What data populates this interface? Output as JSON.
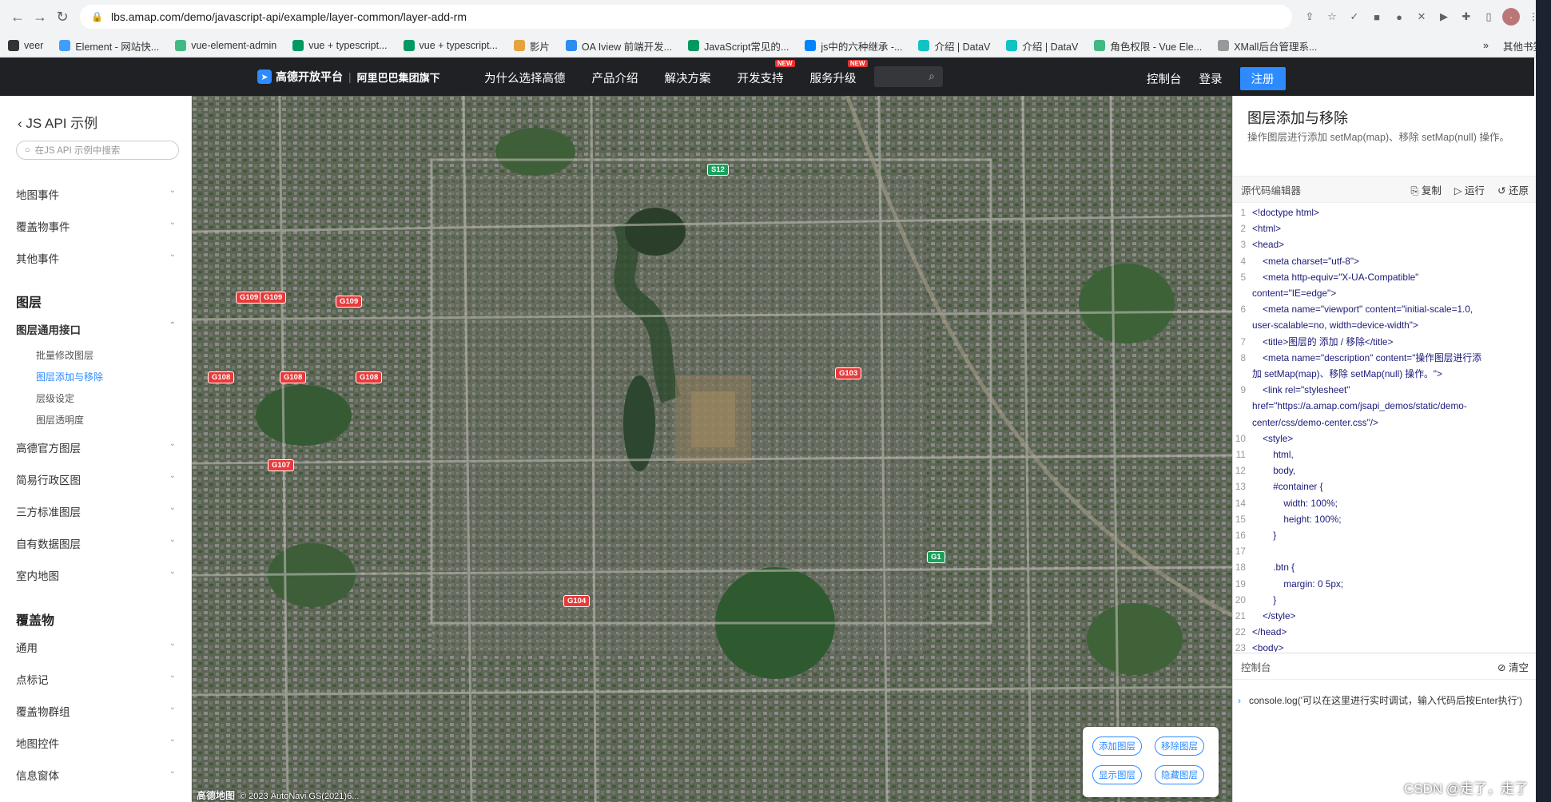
{
  "browser": {
    "url": "lbs.amap.com/demo/javascript-api/example/layer-common/layer-add-rm",
    "bookmarks": [
      {
        "label": "veer",
        "color": "#333"
      },
      {
        "label": "Element - 网站快...",
        "color": "#409eff"
      },
      {
        "label": "vue-element-admin",
        "color": "#42b983"
      },
      {
        "label": "vue + typescript...",
        "color": "#009a61"
      },
      {
        "label": "vue + typescript...",
        "color": "#009a61"
      },
      {
        "label": "影片",
        "color": "#e6a23c"
      },
      {
        "label": "OA Iview 前端开发...",
        "color": "#2d8cf0"
      },
      {
        "label": "JavaScript常见的...",
        "color": "#009a61"
      },
      {
        "label": "js中的六种继承 -...",
        "color": "#0084ff"
      },
      {
        "label": "介绍 | DataV",
        "color": "#13c2c2"
      },
      {
        "label": "介绍 | DataV",
        "color": "#13c2c2"
      },
      {
        "label": "角色权限 - Vue Ele...",
        "color": "#42b983"
      },
      {
        "label": "XMall后台管理系...",
        "color": "#999"
      }
    ],
    "bookmarks_more": "»",
    "other_bookmarks": "其他书签"
  },
  "topnav": {
    "logo": "高德开放平台",
    "logo_sub": "阿里巴巴集团旗下",
    "menu": [
      "为什么选择高德",
      "产品介绍",
      "解决方案",
      "开发支持",
      "服务升级"
    ],
    "new_tag": "NEW",
    "console": "控制台",
    "login": "登录",
    "register": "注册"
  },
  "sidebar": {
    "back": "JS API 示例",
    "search_placeholder": "在JS API 示例中搜索",
    "events": [
      "地图事件",
      "覆盖物事件",
      "其他事件"
    ],
    "layers_head": "图层",
    "layer_common": "图层通用接口",
    "layer_subs": [
      "批量修改图层",
      "图层添加与移除",
      "层级设定",
      "图层透明度"
    ],
    "layer_groups": [
      "高德官方图层",
      "简易行政区图",
      "三方标准图层",
      "自有数据图层",
      "室内地图"
    ],
    "overlays_head": "覆盖物",
    "overlay_groups": [
      "通用",
      "点标记",
      "覆盖物群组",
      "地图控件",
      "信息窗体"
    ]
  },
  "map": {
    "road_labels": [
      {
        "t": "G109",
        "green": false
      },
      {
        "t": "G109",
        "green": false
      },
      {
        "t": "G109",
        "green": false
      },
      {
        "t": "G108",
        "green": false
      },
      {
        "t": "G108",
        "green": false
      },
      {
        "t": "G108",
        "green": false
      },
      {
        "t": "G107",
        "green": false
      },
      {
        "t": "G103",
        "green": false
      },
      {
        "t": "G104",
        "green": false
      },
      {
        "t": "S12",
        "green": true
      },
      {
        "t": "G1",
        "green": true
      }
    ],
    "buttons": {
      "add": "添加图层",
      "remove": "移除图层",
      "show": "显示图层",
      "hide": "隐藏图层"
    },
    "footer_brand": "高德地图",
    "footer_copy": "© 2023 AutoNavi GS(2021)6..."
  },
  "panel": {
    "title": "图层添加与移除",
    "desc": "操作图层进行添加 setMap(map)、移除 setMap(null) 操作。",
    "editor_label": "源代码编辑器",
    "copy": "复制",
    "run": "运行",
    "restore": "还原",
    "code": [
      "<!doctype html>",
      "<html>",
      "<head>",
      "    <meta charset=\"utf-8\">",
      "    <meta http-equiv=\"X-UA-Compatible\"",
      "content=\"IE=edge\">",
      "    <meta name=\"viewport\" content=\"initial-scale=1.0,",
      "user-scalable=no, width=device-width\">",
      "    <title>图层的 添加 / 移除</title>",
      "    <meta name=\"description\" content=\"操作图层进行添",
      "加 setMap(map)、移除 setMap(null) 操作。\">",
      "    <link rel=\"stylesheet\"",
      "href=\"https://a.amap.com/jsapi_demos/static/demo-",
      "center/css/demo-center.css\"/>",
      "    <style>",
      "        html,",
      "        body,",
      "        #container {",
      "            width: 100%;",
      "            height: 100%;",
      "        }",
      "",
      "        .btn {",
      "            margin: 0 5px;",
      "        }",
      "    </style>",
      "</head>",
      "<body>"
    ],
    "line_numbers": [
      "1",
      "2",
      "3",
      "4",
      "5",
      "",
      "6",
      "",
      "7",
      "8",
      "",
      "9",
      "",
      "",
      "10",
      "11",
      "12",
      "13",
      "14",
      "15",
      "16",
      "17",
      "18",
      "19",
      "20",
      "21",
      "22",
      "23"
    ],
    "console_label": "控制台",
    "clear": "清空",
    "console_text": "console.log('可以在这里进行实时调试，输入代码后按Enter执行')"
  },
  "watermark": "CSDN @走了，走了"
}
